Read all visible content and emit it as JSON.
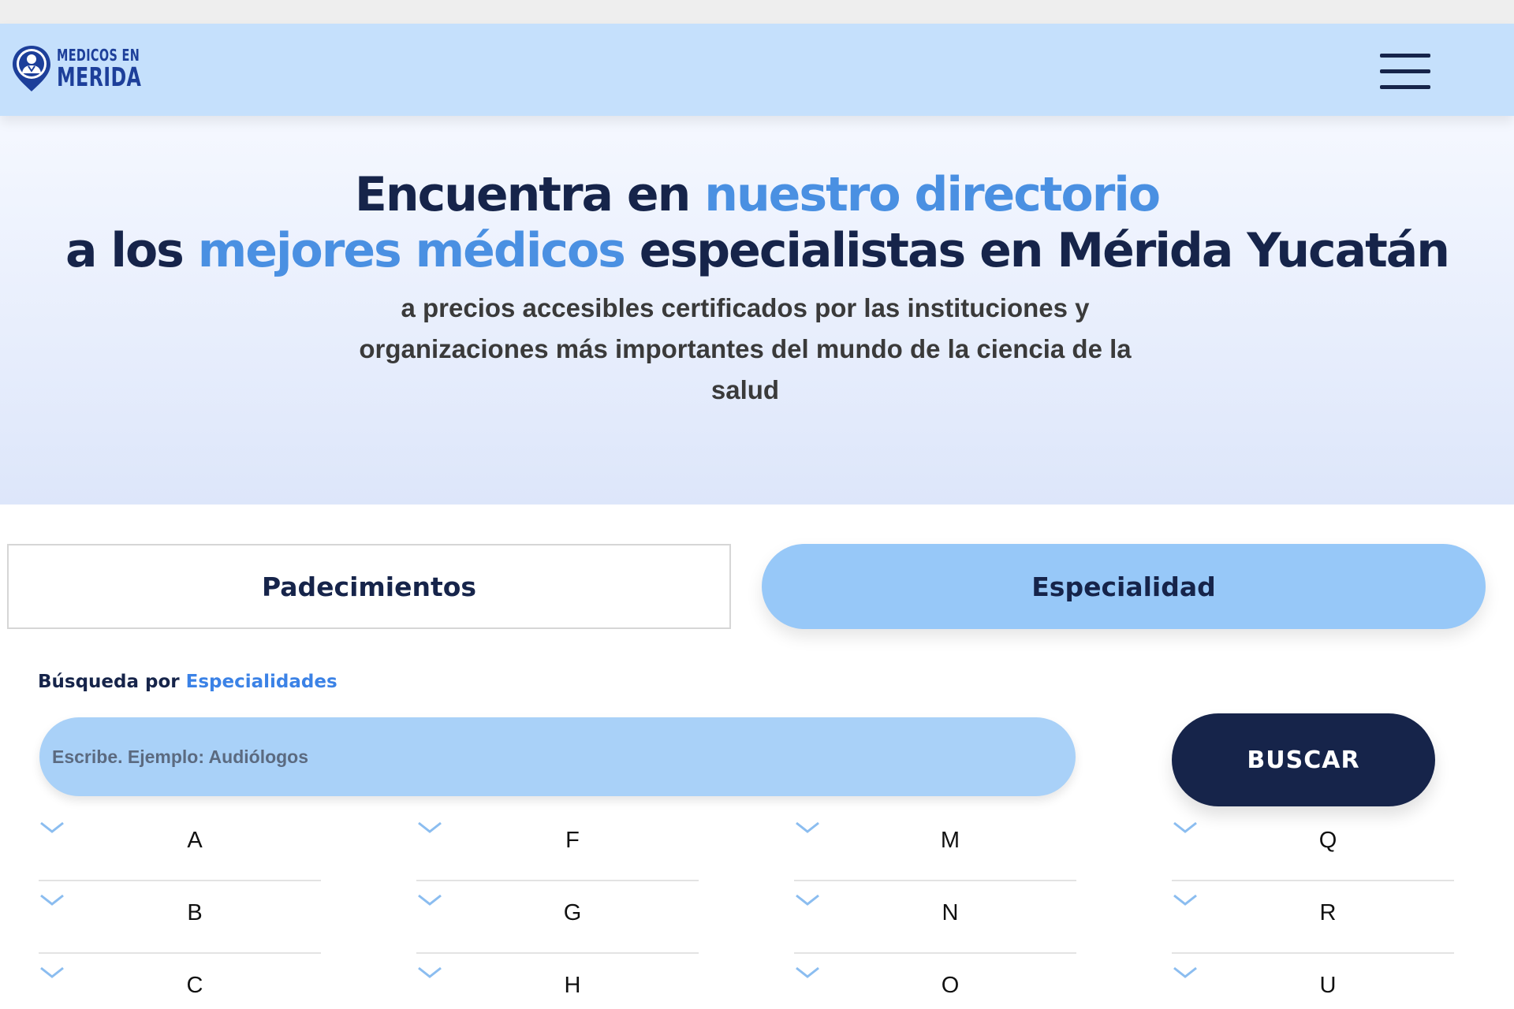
{
  "navbar": {
    "logo_line1": "MEDICOS EN",
    "logo_line2": "MERIDA",
    "menu_icon": "hamburger-menu-icon"
  },
  "hero": {
    "title_line1_part1": "Encuentra en ",
    "title_line1_accent": "nuestro directorio",
    "title_line2_part1": "a los ",
    "title_line2_accent": "mejores médicos",
    "title_line2_part2": " especialistas en Mérida Yucatán",
    "subtitle": "a precios accesibles certificados por las instituciones y organizaciones más importantes del mundo de la ciencia de la salud"
  },
  "tabs": [
    {
      "label": "Padecimientos",
      "active": false
    },
    {
      "label": "Especialidad",
      "active": true
    }
  ],
  "search": {
    "label_prefix": "Búsqueda por ",
    "label_accent": "Especialidades",
    "placeholder": "Escribe. Ejemplo: Audiólogos",
    "button_label": "BUSCAR"
  },
  "letters": {
    "col1": [
      "A",
      "B",
      "C"
    ],
    "col2": [
      "F",
      "G",
      "H"
    ],
    "col3": [
      "M",
      "N",
      "O"
    ],
    "col4": [
      "Q",
      "R",
      "U"
    ]
  },
  "colors": {
    "navbar_bg": "#c5e0fc",
    "brand_dark": "#16244a",
    "accent": "#4a90e2",
    "tab_active_bg": "#97c8f8",
    "input_bg": "#a9d1f8"
  }
}
